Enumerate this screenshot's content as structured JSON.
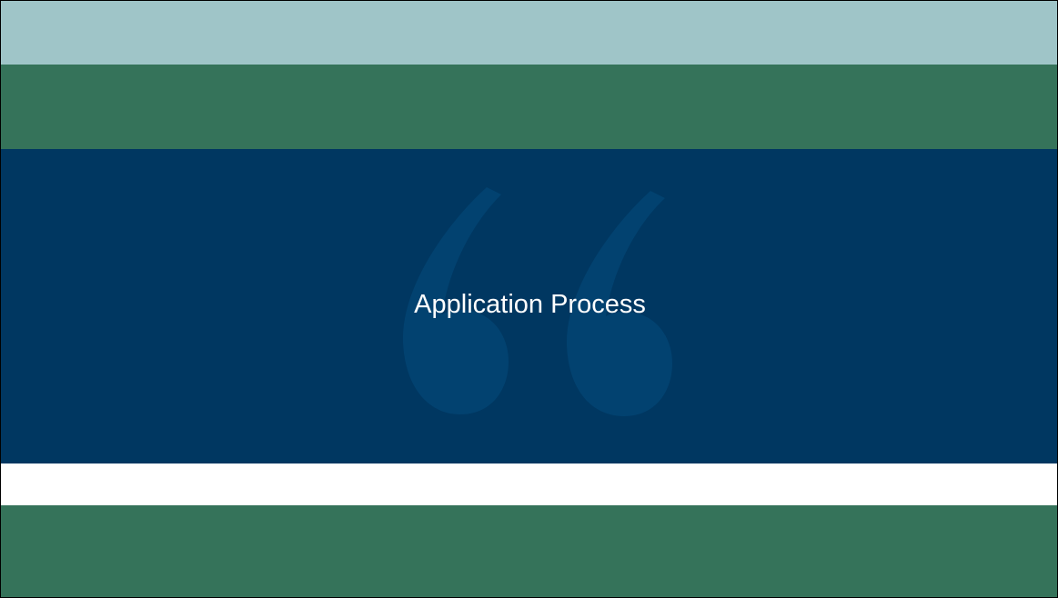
{
  "slide": {
    "title": "Application Process"
  },
  "colors": {
    "top_band": "#9fc5c8",
    "green_band": "#35735a",
    "navy_band": "#003761",
    "quote_mark": "#024270",
    "title_text": "#ffffff"
  },
  "icons": {
    "decorative_quote": "open-double-quote-icon"
  }
}
